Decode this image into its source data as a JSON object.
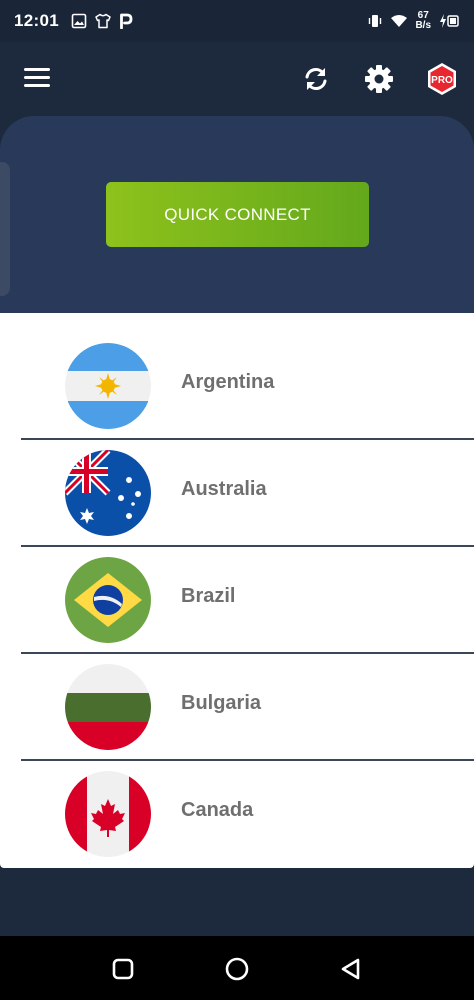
{
  "status_bar": {
    "time": "12:01",
    "net_speed_value": "67",
    "net_speed_unit": "B/s",
    "left_icons": [
      "gallery-icon",
      "tshirt-icon",
      "p-app-icon"
    ],
    "right_icons": [
      "vibrate-icon",
      "wifi-icon",
      "battery-charging-icon"
    ]
  },
  "app_bar": {
    "menu_icon": "hamburger-menu-icon",
    "refresh_icon": "refresh-icon",
    "settings_icon": "gear-icon",
    "pro_badge": "PRO"
  },
  "hero": {
    "quick_connect_label": "QUICK CONNECT",
    "accent_color": "#8ec21c"
  },
  "countries": [
    {
      "name": "Argentina",
      "flag": "argentina-flag"
    },
    {
      "name": "Australia",
      "flag": "australia-flag"
    },
    {
      "name": "Brazil",
      "flag": "brazil-flag"
    },
    {
      "name": "Bulgaria",
      "flag": "bulgaria-flag"
    },
    {
      "name": "Canada",
      "flag": "canada-flag"
    }
  ],
  "nav_bar": {
    "buttons": [
      "recents-square-icon",
      "home-circle-icon",
      "back-triangle-icon"
    ]
  }
}
